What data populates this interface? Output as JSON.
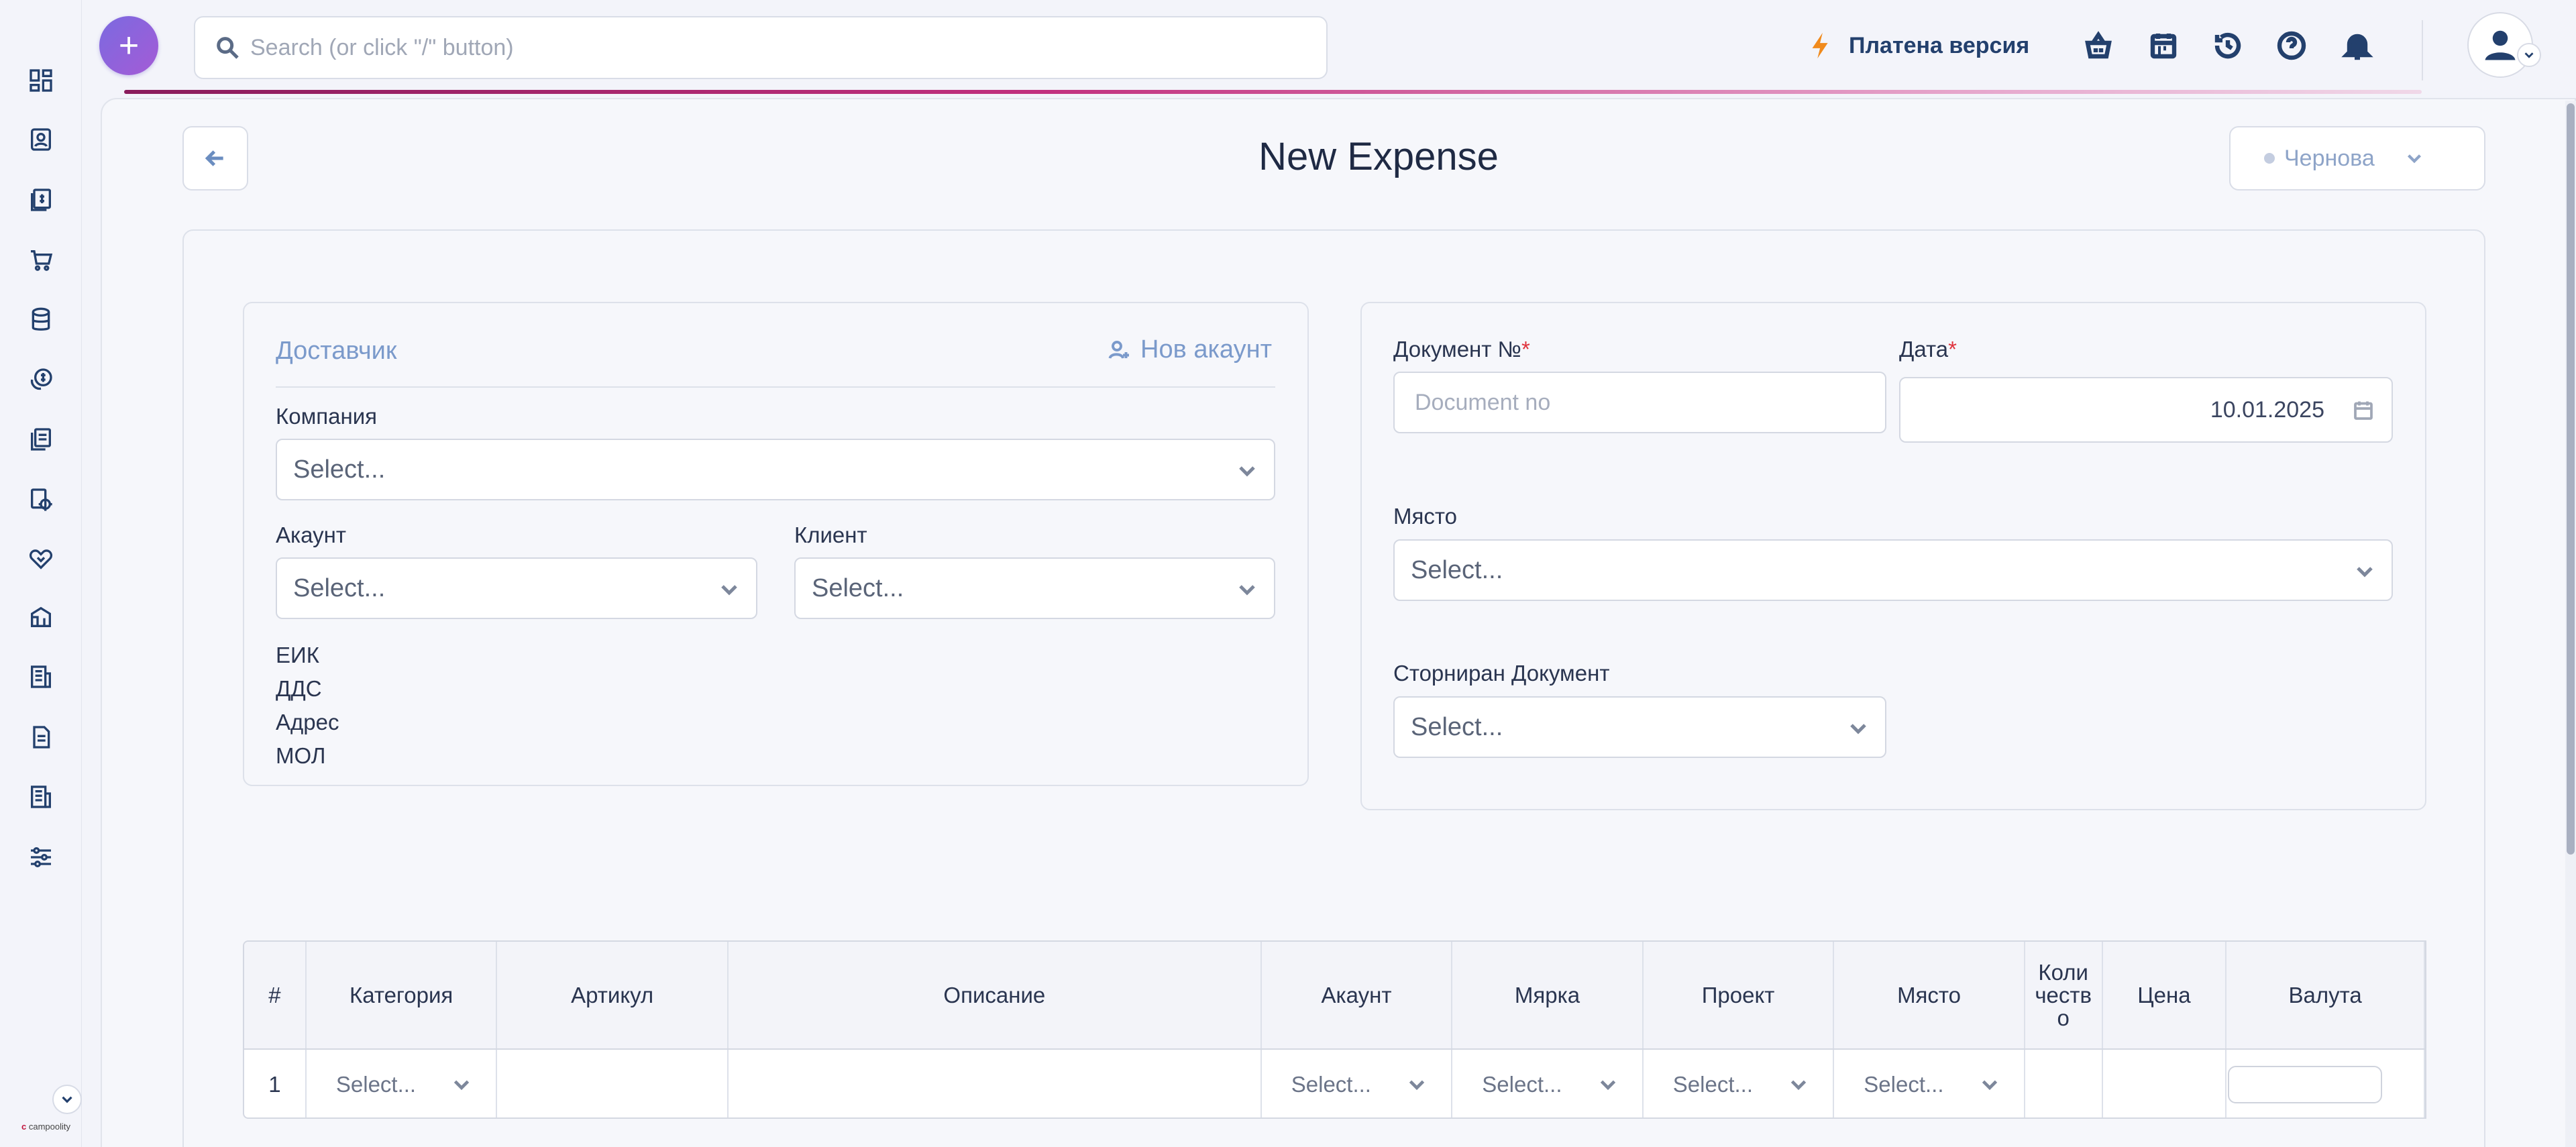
{
  "search": {
    "placeholder": "Search (or click \"/\" button)"
  },
  "header": {
    "plan_label": "Платена версия",
    "add_symbol": "+"
  },
  "footer": {
    "brand": "campoolity"
  },
  "page": {
    "title": "New Expense",
    "status": "Чернова"
  },
  "supplier": {
    "heading": "Доставчик",
    "new_account": "Нов акаунт",
    "company_label": "Компания",
    "company_value": "Select...",
    "account_label": "Акаунт",
    "account_value": "Select...",
    "client_label": "Клиент",
    "client_value": "Select...",
    "info": [
      "ЕИК",
      "ДДС",
      "Адрес",
      "МОЛ"
    ]
  },
  "document": {
    "number_label": "Документ №",
    "number_placeholder": "Document no",
    "date_label": "Дата",
    "date_value": "10.01.2025",
    "place_label": "Място",
    "place_value": "Select...",
    "reversed_label": "Сторниран Документ",
    "reversed_value": "Select...",
    "required_mark": "*"
  },
  "table": {
    "headers": [
      "#",
      "Категория",
      "Артикул",
      "Описание",
      "Акаунт",
      "Мярка",
      "Проект",
      "Място",
      "Коли честв о",
      "Цена",
      "Валута"
    ],
    "rows": [
      {
        "index": "1",
        "category": "Select...",
        "article": "",
        "description": "",
        "account": "Select...",
        "unit": "Select...",
        "project": "Select...",
        "place": "Select...",
        "quantity": "",
        "price": "",
        "currency": ""
      }
    ]
  },
  "colors": {
    "primary": "#23406d",
    "accent": "#7b9acb",
    "add_button_gradient": [
      "#7b6ae0",
      "#a45bd6"
    ],
    "plan_icon": "#f08a1c",
    "required": "#e0333d",
    "progress": [
      "#8a1c5c",
      "#c2307e",
      "#e6a6cc"
    ]
  },
  "icons": {
    "sidebar": [
      "dashboard-icon",
      "contacts-icon",
      "invoices-icon",
      "cart-icon",
      "database-icon",
      "money-icon",
      "documents-icon",
      "settings-gear-icon",
      "handshake-icon",
      "box-icon",
      "reports-icon",
      "file-icon",
      "ledger-icon",
      "sliders-icon"
    ],
    "topbar": [
      "lightning-icon",
      "basket-icon",
      "calendar-icon",
      "history-icon",
      "help-icon",
      "bell-icon",
      "user-icon"
    ]
  }
}
